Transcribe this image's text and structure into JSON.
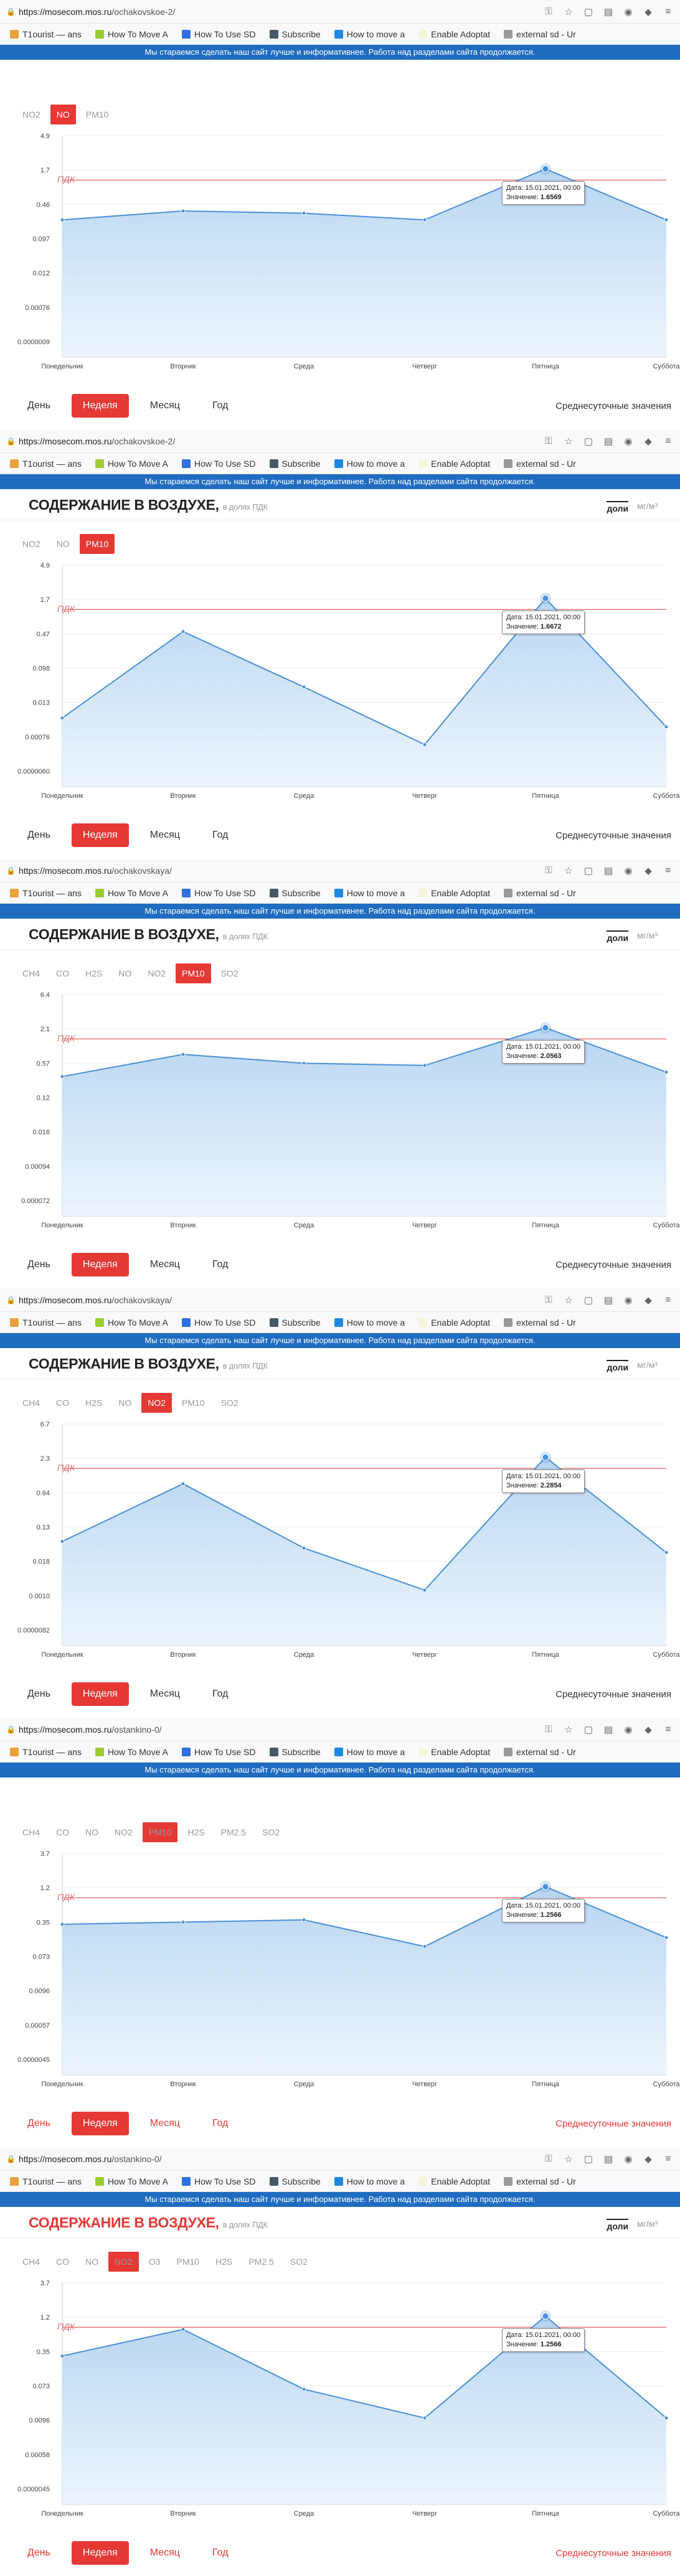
{
  "bookmarks": [
    {
      "label": "T1ourist — ans",
      "color": "#e6a23c"
    },
    {
      "label": "How To Move A",
      "color": "#9acd32"
    },
    {
      "label": "How To Use SD",
      "color": "#2f6fdf"
    },
    {
      "label": "Subscribe",
      "color": "#455a64"
    },
    {
      "label": "How to move a",
      "color": "#1e88e5"
    },
    {
      "label": "Enable Adoptat",
      "color": "#f5f5dc"
    },
    {
      "label": "external sd - Ur",
      "color": "#999999"
    }
  ],
  "banner_text": "Мы стараемся сделать наш сайт лучше и информативнее. Работа над разделами сайта продолжается.",
  "title": "СОДЕРЖАНИЕ В ВОЗДУХЕ,",
  "title_sub": "в долях ПДК",
  "unit_doli": "доли",
  "unit_mg": "мг/м³",
  "periods": [
    "День",
    "Неделя",
    "Месяц",
    "Год"
  ],
  "avg_label": "Среднесуточные значения",
  "pdk_label": "ПДК",
  "days": [
    "Понедельник",
    "Вторник",
    "Среда",
    "Четверг",
    "Пятница",
    "Суббота"
  ],
  "tip_date": "Дата: 15.01.2021, 00:00",
  "tip_value_prefix": "Значение: ",
  "panels": [
    {
      "url_host": "https://mosecom.mos.ru",
      "url_path": "/ochakovskoe-2/",
      "pollutants": [
        "NO2",
        "NO",
        "PM10"
      ],
      "active": 1,
      "showTitle": false,
      "showBookmarks": true,
      "yticks": [
        "4.9",
        "1.7",
        "0.46",
        "0.097",
        "0.012",
        "0.00076",
        "0.0000009"
      ],
      "values": [
        0.62,
        0.66,
        0.65,
        0.62,
        0.85,
        0.62
      ],
      "tipValue": "1.6569",
      "red": false
    },
    {
      "url_host": "https://mosecom.mos.ru",
      "url_path": "/ochakovskoe-2/",
      "pollutants": [
        "NO2",
        "NO",
        "PM10"
      ],
      "active": 2,
      "showTitle": true,
      "showBookmarks": true,
      "yticks": [
        "4.9",
        "1.7",
        "0.47",
        "0.098",
        "0.013",
        "0.00076",
        "0.0000060"
      ],
      "values": [
        0.31,
        0.7,
        0.45,
        0.19,
        0.85,
        0.27
      ],
      "tipValue": "1.6672",
      "red": false
    },
    {
      "url_host": "https://mosecom.mos.ru",
      "url_path": "/ochakovskaya/",
      "pollutants": [
        "CH4",
        "CO",
        "H2S",
        "NO",
        "NO2",
        "PM10",
        "SO2"
      ],
      "active": 5,
      "showTitle": true,
      "showBookmarks": true,
      "yticks": [
        "6.4",
        "2.1",
        "0.57",
        "0.12",
        "0.016",
        "0.00094",
        "0.000072"
      ],
      "values": [
        0.63,
        0.73,
        0.69,
        0.68,
        0.85,
        0.65
      ],
      "tipValue": "2.0563",
      "red": false
    },
    {
      "url_host": "https://mosecom.mos.ru",
      "url_path": "/ochakovskaya/",
      "pollutants": [
        "CH4",
        "CO",
        "H2S",
        "NO",
        "NO2",
        "PM10",
        "SO2"
      ],
      "active": 4,
      "showTitle": true,
      "showBookmarks": true,
      "yticks": [
        "6.7",
        "2.3",
        "0.64",
        "0.13",
        "0.018",
        "0.0010",
        "0.0000082"
      ],
      "values": [
        0.47,
        0.73,
        0.44,
        0.25,
        0.85,
        0.42
      ],
      "tipValue": "2.2854",
      "red": false
    },
    {
      "url_host": "https://mosecom.mos.ru",
      "url_path": "/ostankino-0/",
      "pollutants": [
        "CH4",
        "CO",
        "NO",
        "NO2",
        "PM10",
        "H2S",
        "PM2.5",
        "SO2"
      ],
      "active": 4,
      "showTitle": false,
      "showBookmarks": true,
      "yticks": [
        "3.7",
        "1.2",
        "0.35",
        "0.073",
        "0.0096",
        "0.00057",
        "0.0000045"
      ],
      "values": [
        0.68,
        0.69,
        0.7,
        0.58,
        0.85,
        0.62
      ],
      "tipValue": "1.2566",
      "red": true
    },
    {
      "url_host": "https://mosecom.mos.ru",
      "url_path": "/ostankino-0/",
      "pollutants": [
        "CH4",
        "CO",
        "NO",
        "NO2",
        "O3",
        "PM10",
        "H2S",
        "PM2.5",
        "SO2"
      ],
      "active": 3,
      "showTitle": true,
      "showBookmarks": true,
      "yticks": [
        "3.7",
        "1.2",
        "0.35",
        "0.073",
        "0.0096",
        "0.00058",
        "0.0000045"
      ],
      "values": [
        0.67,
        0.79,
        0.52,
        0.39,
        0.85,
        0.39
      ],
      "tipValue": "1.2566",
      "red": true
    }
  ]
}
